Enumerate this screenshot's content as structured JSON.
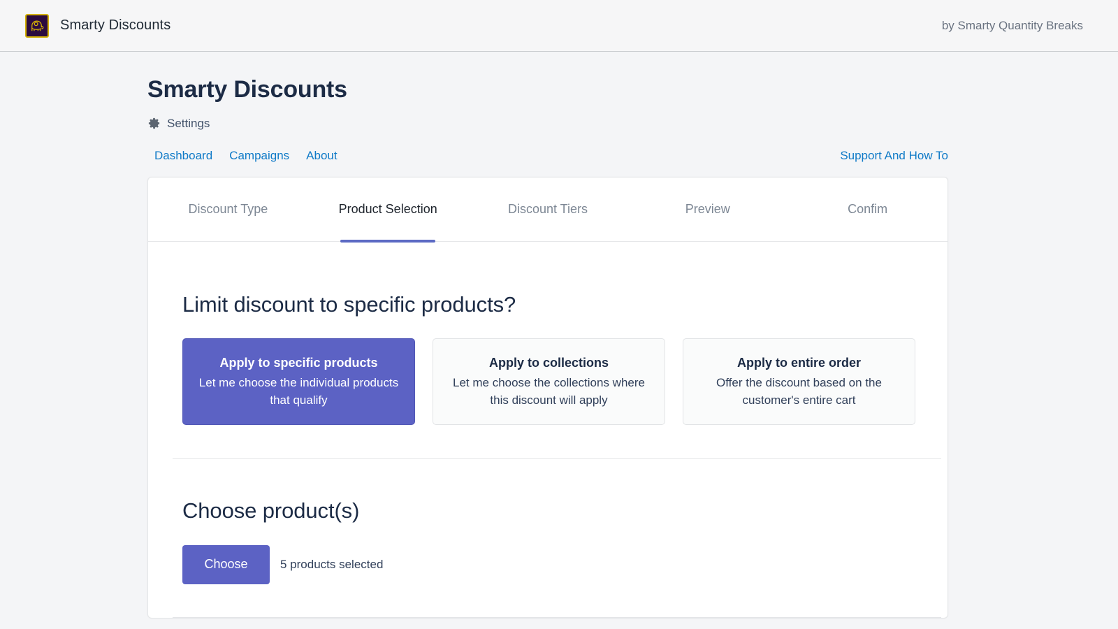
{
  "appbar": {
    "logo_icon": "elephant-logo-icon",
    "app_name": "Smarty Discounts",
    "byline": "by Smarty Quantity Breaks"
  },
  "page": {
    "title": "Smarty Discounts",
    "settings_icon": "gear-icon",
    "settings_label": "Settings"
  },
  "nav": {
    "links": [
      {
        "label": "Dashboard"
      },
      {
        "label": "Campaigns"
      },
      {
        "label": "About"
      }
    ],
    "support_label": "Support And How To"
  },
  "tabs": [
    {
      "label": "Discount Type",
      "active": false
    },
    {
      "label": "Product Selection",
      "active": true
    },
    {
      "label": "Discount Tiers",
      "active": false
    },
    {
      "label": "Preview",
      "active": false
    },
    {
      "label": "Confim",
      "active": false
    }
  ],
  "limit_section": {
    "heading": "Limit discount to specific products?",
    "options": [
      {
        "title": "Apply to specific products",
        "desc": "Let me choose the individual products that qualify",
        "selected": true
      },
      {
        "title": "Apply to collections",
        "desc": "Let me choose the collections where this discount will apply",
        "selected": false
      },
      {
        "title": "Apply to entire order",
        "desc": "Offer the discount based on the customer's entire cart",
        "selected": false
      }
    ]
  },
  "choose_section": {
    "heading": "Choose product(s)",
    "choose_button": "Choose",
    "selected_count": "5 products selected"
  },
  "colors": {
    "accent": "#5c62c4",
    "link": "#0f7ac7",
    "page_bg": "#f4f5f7",
    "logo_bg": "#2b0b3f",
    "logo_border": "#d4b106"
  }
}
